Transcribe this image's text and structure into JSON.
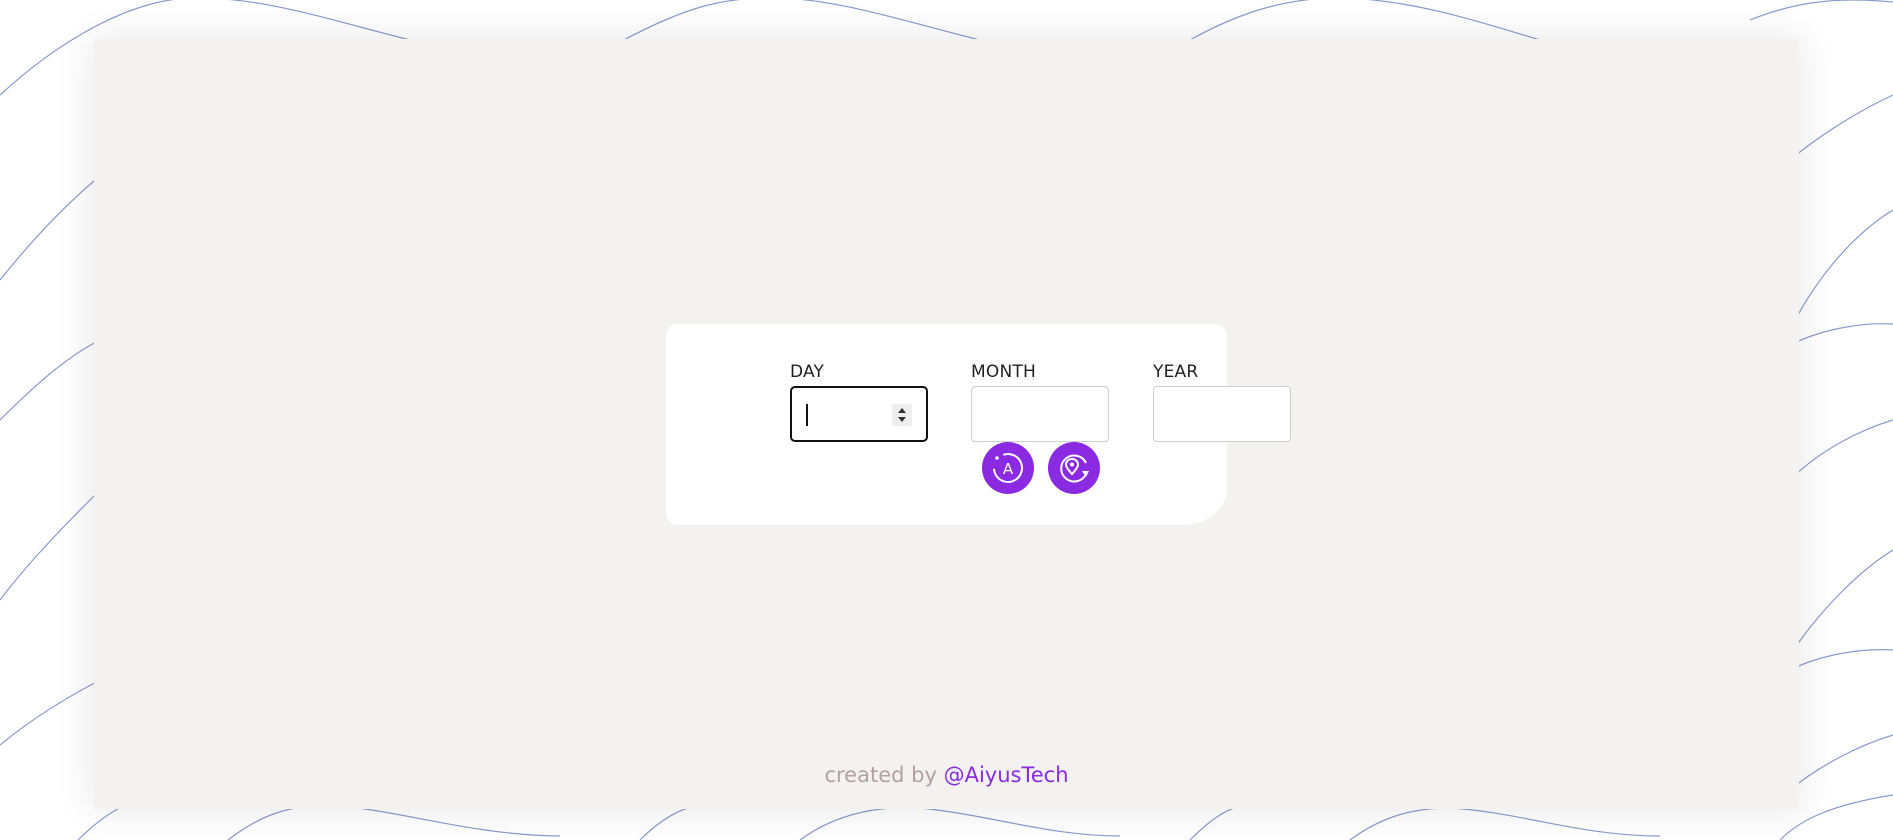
{
  "form": {
    "day": {
      "label": "DAY",
      "value": ""
    },
    "month": {
      "label": "MONTH",
      "value": ""
    },
    "year": {
      "label": "YEAR",
      "value": ""
    }
  },
  "actions": [
    {
      "icon": "auto-refresh-icon"
    },
    {
      "icon": "location-refresh-icon"
    }
  ],
  "footer": {
    "prefix": "created by",
    "handle": "@AiyusTech"
  },
  "colors": {
    "accent": "#8a2be2",
    "panel": "#f3f2f1",
    "card": "#ffffff",
    "credit_text": "#b3a0a0",
    "wave_lines": "#7d8fc2"
  }
}
